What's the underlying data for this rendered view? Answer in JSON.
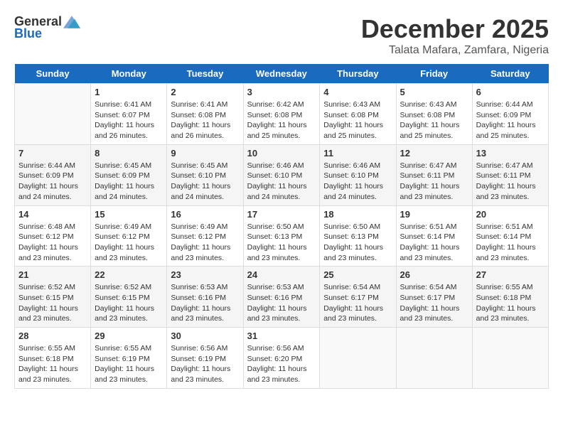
{
  "logo": {
    "general": "General",
    "blue": "Blue"
  },
  "title": {
    "month": "December 2025",
    "location": "Talata Mafara, Zamfara, Nigeria"
  },
  "headers": [
    "Sunday",
    "Monday",
    "Tuesday",
    "Wednesday",
    "Thursday",
    "Friday",
    "Saturday"
  ],
  "weeks": [
    [
      {
        "day": "",
        "info": ""
      },
      {
        "day": "1",
        "info": "Sunrise: 6:41 AM\nSunset: 6:07 PM\nDaylight: 11 hours\nand 26 minutes."
      },
      {
        "day": "2",
        "info": "Sunrise: 6:41 AM\nSunset: 6:08 PM\nDaylight: 11 hours\nand 26 minutes."
      },
      {
        "day": "3",
        "info": "Sunrise: 6:42 AM\nSunset: 6:08 PM\nDaylight: 11 hours\nand 25 minutes."
      },
      {
        "day": "4",
        "info": "Sunrise: 6:43 AM\nSunset: 6:08 PM\nDaylight: 11 hours\nand 25 minutes."
      },
      {
        "day": "5",
        "info": "Sunrise: 6:43 AM\nSunset: 6:08 PM\nDaylight: 11 hours\nand 25 minutes."
      },
      {
        "day": "6",
        "info": "Sunrise: 6:44 AM\nSunset: 6:09 PM\nDaylight: 11 hours\nand 25 minutes."
      }
    ],
    [
      {
        "day": "7",
        "info": "Sunrise: 6:44 AM\nSunset: 6:09 PM\nDaylight: 11 hours\nand 24 minutes."
      },
      {
        "day": "8",
        "info": "Sunrise: 6:45 AM\nSunset: 6:09 PM\nDaylight: 11 hours\nand 24 minutes."
      },
      {
        "day": "9",
        "info": "Sunrise: 6:45 AM\nSunset: 6:10 PM\nDaylight: 11 hours\nand 24 minutes."
      },
      {
        "day": "10",
        "info": "Sunrise: 6:46 AM\nSunset: 6:10 PM\nDaylight: 11 hours\nand 24 minutes."
      },
      {
        "day": "11",
        "info": "Sunrise: 6:46 AM\nSunset: 6:10 PM\nDaylight: 11 hours\nand 24 minutes."
      },
      {
        "day": "12",
        "info": "Sunrise: 6:47 AM\nSunset: 6:11 PM\nDaylight: 11 hours\nand 23 minutes."
      },
      {
        "day": "13",
        "info": "Sunrise: 6:47 AM\nSunset: 6:11 PM\nDaylight: 11 hours\nand 23 minutes."
      }
    ],
    [
      {
        "day": "14",
        "info": "Sunrise: 6:48 AM\nSunset: 6:12 PM\nDaylight: 11 hours\nand 23 minutes."
      },
      {
        "day": "15",
        "info": "Sunrise: 6:49 AM\nSunset: 6:12 PM\nDaylight: 11 hours\nand 23 minutes."
      },
      {
        "day": "16",
        "info": "Sunrise: 6:49 AM\nSunset: 6:12 PM\nDaylight: 11 hours\nand 23 minutes."
      },
      {
        "day": "17",
        "info": "Sunrise: 6:50 AM\nSunset: 6:13 PM\nDaylight: 11 hours\nand 23 minutes."
      },
      {
        "day": "18",
        "info": "Sunrise: 6:50 AM\nSunset: 6:13 PM\nDaylight: 11 hours\nand 23 minutes."
      },
      {
        "day": "19",
        "info": "Sunrise: 6:51 AM\nSunset: 6:14 PM\nDaylight: 11 hours\nand 23 minutes."
      },
      {
        "day": "20",
        "info": "Sunrise: 6:51 AM\nSunset: 6:14 PM\nDaylight: 11 hours\nand 23 minutes."
      }
    ],
    [
      {
        "day": "21",
        "info": "Sunrise: 6:52 AM\nSunset: 6:15 PM\nDaylight: 11 hours\nand 23 minutes."
      },
      {
        "day": "22",
        "info": "Sunrise: 6:52 AM\nSunset: 6:15 PM\nDaylight: 11 hours\nand 23 minutes."
      },
      {
        "day": "23",
        "info": "Sunrise: 6:53 AM\nSunset: 6:16 PM\nDaylight: 11 hours\nand 23 minutes."
      },
      {
        "day": "24",
        "info": "Sunrise: 6:53 AM\nSunset: 6:16 PM\nDaylight: 11 hours\nand 23 minutes."
      },
      {
        "day": "25",
        "info": "Sunrise: 6:54 AM\nSunset: 6:17 PM\nDaylight: 11 hours\nand 23 minutes."
      },
      {
        "day": "26",
        "info": "Sunrise: 6:54 AM\nSunset: 6:17 PM\nDaylight: 11 hours\nand 23 minutes."
      },
      {
        "day": "27",
        "info": "Sunrise: 6:55 AM\nSunset: 6:18 PM\nDaylight: 11 hours\nand 23 minutes."
      }
    ],
    [
      {
        "day": "28",
        "info": "Sunrise: 6:55 AM\nSunset: 6:18 PM\nDaylight: 11 hours\nand 23 minutes."
      },
      {
        "day": "29",
        "info": "Sunrise: 6:55 AM\nSunset: 6:19 PM\nDaylight: 11 hours\nand 23 minutes."
      },
      {
        "day": "30",
        "info": "Sunrise: 6:56 AM\nSunset: 6:19 PM\nDaylight: 11 hours\nand 23 minutes."
      },
      {
        "day": "31",
        "info": "Sunrise: 6:56 AM\nSunset: 6:20 PM\nDaylight: 11 hours\nand 23 minutes."
      },
      {
        "day": "",
        "info": ""
      },
      {
        "day": "",
        "info": ""
      },
      {
        "day": "",
        "info": ""
      }
    ]
  ]
}
